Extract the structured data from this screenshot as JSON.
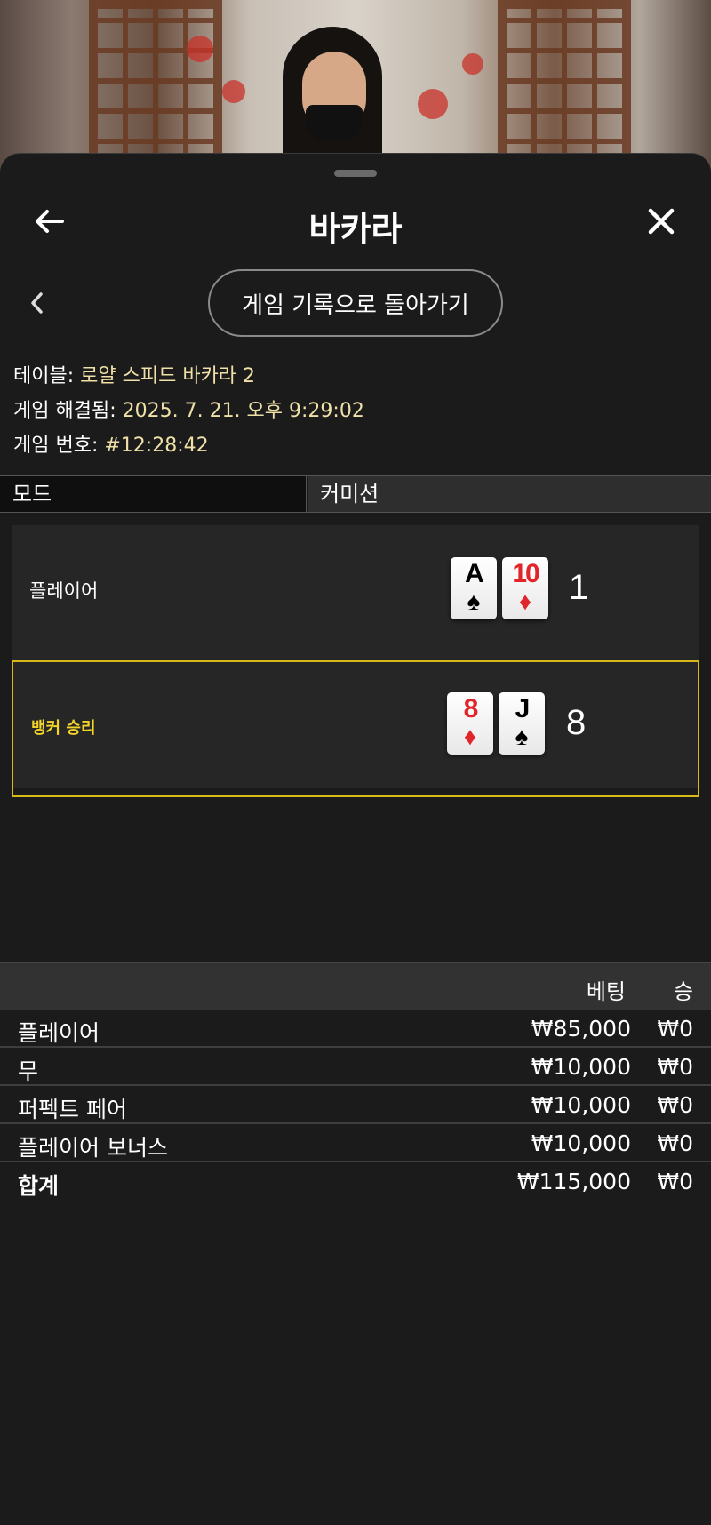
{
  "header": {
    "title": "바카라"
  },
  "nav": {
    "back_to_history_label": "게임 기록으로 돌아가기"
  },
  "info": {
    "table_label": "테이블:",
    "table_value": "로얄 스피드 바카라 2",
    "resolved_label": "게임 해결됨:",
    "resolved_value": "2025. 7. 21. 오후 9:29:02",
    "number_label": "게임 번호:",
    "number_value": "#12:28:42"
  },
  "mode": {
    "label": "모드",
    "value": "커미션"
  },
  "result": {
    "player": {
      "label": "플레이어",
      "cards": [
        {
          "rank": "A",
          "suit": "♠",
          "color": "black"
        },
        {
          "rank": "10",
          "suit": "♦",
          "color": "red"
        }
      ],
      "score": "1"
    },
    "banker": {
      "label": "뱅커 승리",
      "cards": [
        {
          "rank": "8",
          "suit": "♦",
          "color": "red"
        },
        {
          "rank": "J",
          "suit": "♠",
          "color": "black"
        }
      ],
      "score": "8"
    },
    "winner_color": "#d9b81a"
  },
  "bets": {
    "columns": {
      "bet": "베팅",
      "win": "승"
    },
    "rows": [
      {
        "name": "플레이어",
        "bet": "₩85,000",
        "win": "₩0"
      },
      {
        "name": "무",
        "bet": "₩10,000",
        "win": "₩0"
      },
      {
        "name": "퍼펙트 페어",
        "bet": "₩10,000",
        "win": "₩0"
      },
      {
        "name": "플레이어 보너스",
        "bet": "₩10,000",
        "win": "₩0"
      }
    ],
    "total": {
      "name": "합계",
      "bet": "₩115,000",
      "win": "₩0"
    }
  },
  "icons": {
    "back": "arrow-left-icon",
    "close": "close-icon",
    "prev": "chevron-left-icon"
  }
}
